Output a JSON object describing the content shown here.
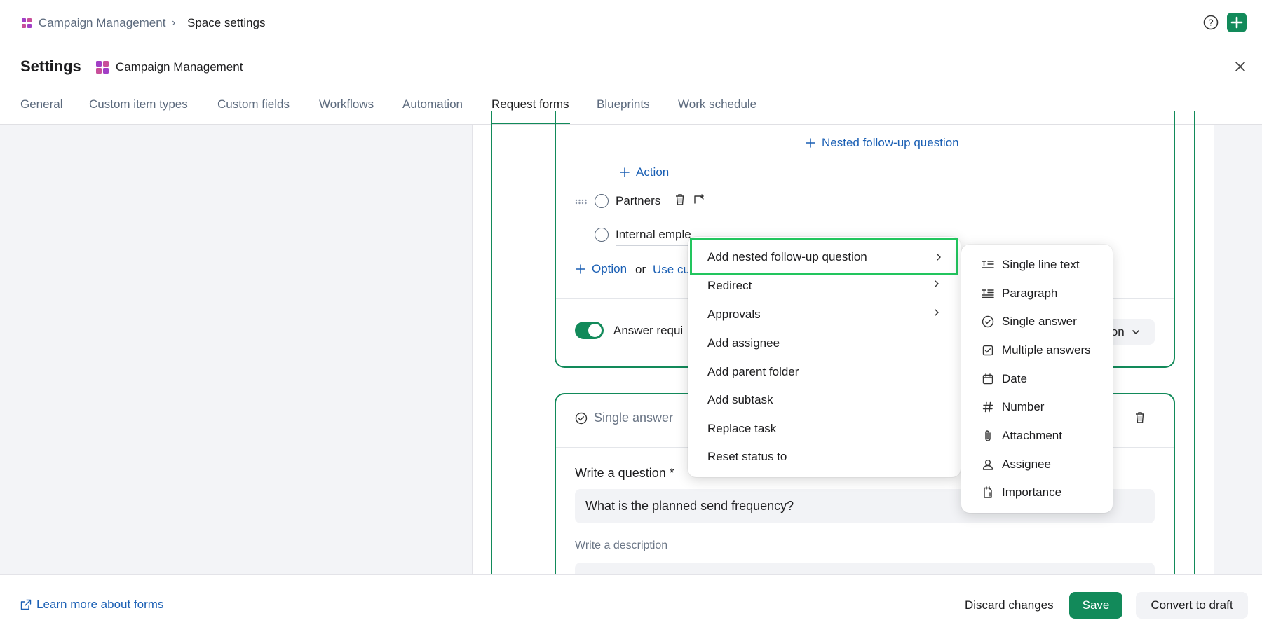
{
  "breadcrumb": {
    "space": "Campaign Management",
    "current": "Space settings"
  },
  "settings": {
    "title": "Settings",
    "space_name": "Campaign Management"
  },
  "tabs": [
    "General",
    "Custom item types",
    "Custom fields",
    "Workflows",
    "Automation",
    "Request forms",
    "Blueprints",
    "Work schedule"
  ],
  "active_tab": "Request forms",
  "form": {
    "nested_followup": "Nested follow-up question",
    "action": "Action",
    "option_1": "Partners",
    "option_2": "Internal emple",
    "add_option": "Option",
    "or": "or",
    "use_custom": "Use cu",
    "answer_required": "Answer requi",
    "right_select_partial": "ion",
    "card2_type": "Single answer",
    "question_label": "Write a question *",
    "question_value": "What is the planned send frequency?",
    "description_label": "Write a description"
  },
  "context_menu": [
    {
      "label": "Add nested follow-up question",
      "has_submenu": true,
      "highlighted": true
    },
    {
      "label": "Redirect",
      "has_submenu": true
    },
    {
      "label": "Approvals",
      "has_submenu": true
    },
    {
      "label": "Add assignee",
      "has_submenu": false
    },
    {
      "label": "Add parent folder",
      "has_submenu": false
    },
    {
      "label": "Add subtask",
      "has_submenu": false
    },
    {
      "label": "Replace task",
      "has_submenu": false
    },
    {
      "label": "Reset status to",
      "has_submenu": false
    }
  ],
  "submenu": [
    {
      "label": "Single line text",
      "icon": "single-line-text-icon"
    },
    {
      "label": "Paragraph",
      "icon": "paragraph-icon"
    },
    {
      "label": "Single answer",
      "icon": "single-answer-icon"
    },
    {
      "label": "Multiple answers",
      "icon": "multiple-answers-icon"
    },
    {
      "label": "Date",
      "icon": "calendar-icon"
    },
    {
      "label": "Number",
      "icon": "hash-icon"
    },
    {
      "label": "Attachment",
      "icon": "paperclip-icon"
    },
    {
      "label": "Assignee",
      "icon": "person-icon"
    },
    {
      "label": "Importance",
      "icon": "importance-icon"
    }
  ],
  "footer": {
    "learn_more": "Learn more about forms",
    "discard": "Discard changes",
    "save": "Save",
    "convert": "Convert to draft"
  },
  "colors": {
    "accent": "#128a5a",
    "link": "#1a5fb4",
    "highlight": "#22c55e",
    "brand": "#a23fc6"
  }
}
